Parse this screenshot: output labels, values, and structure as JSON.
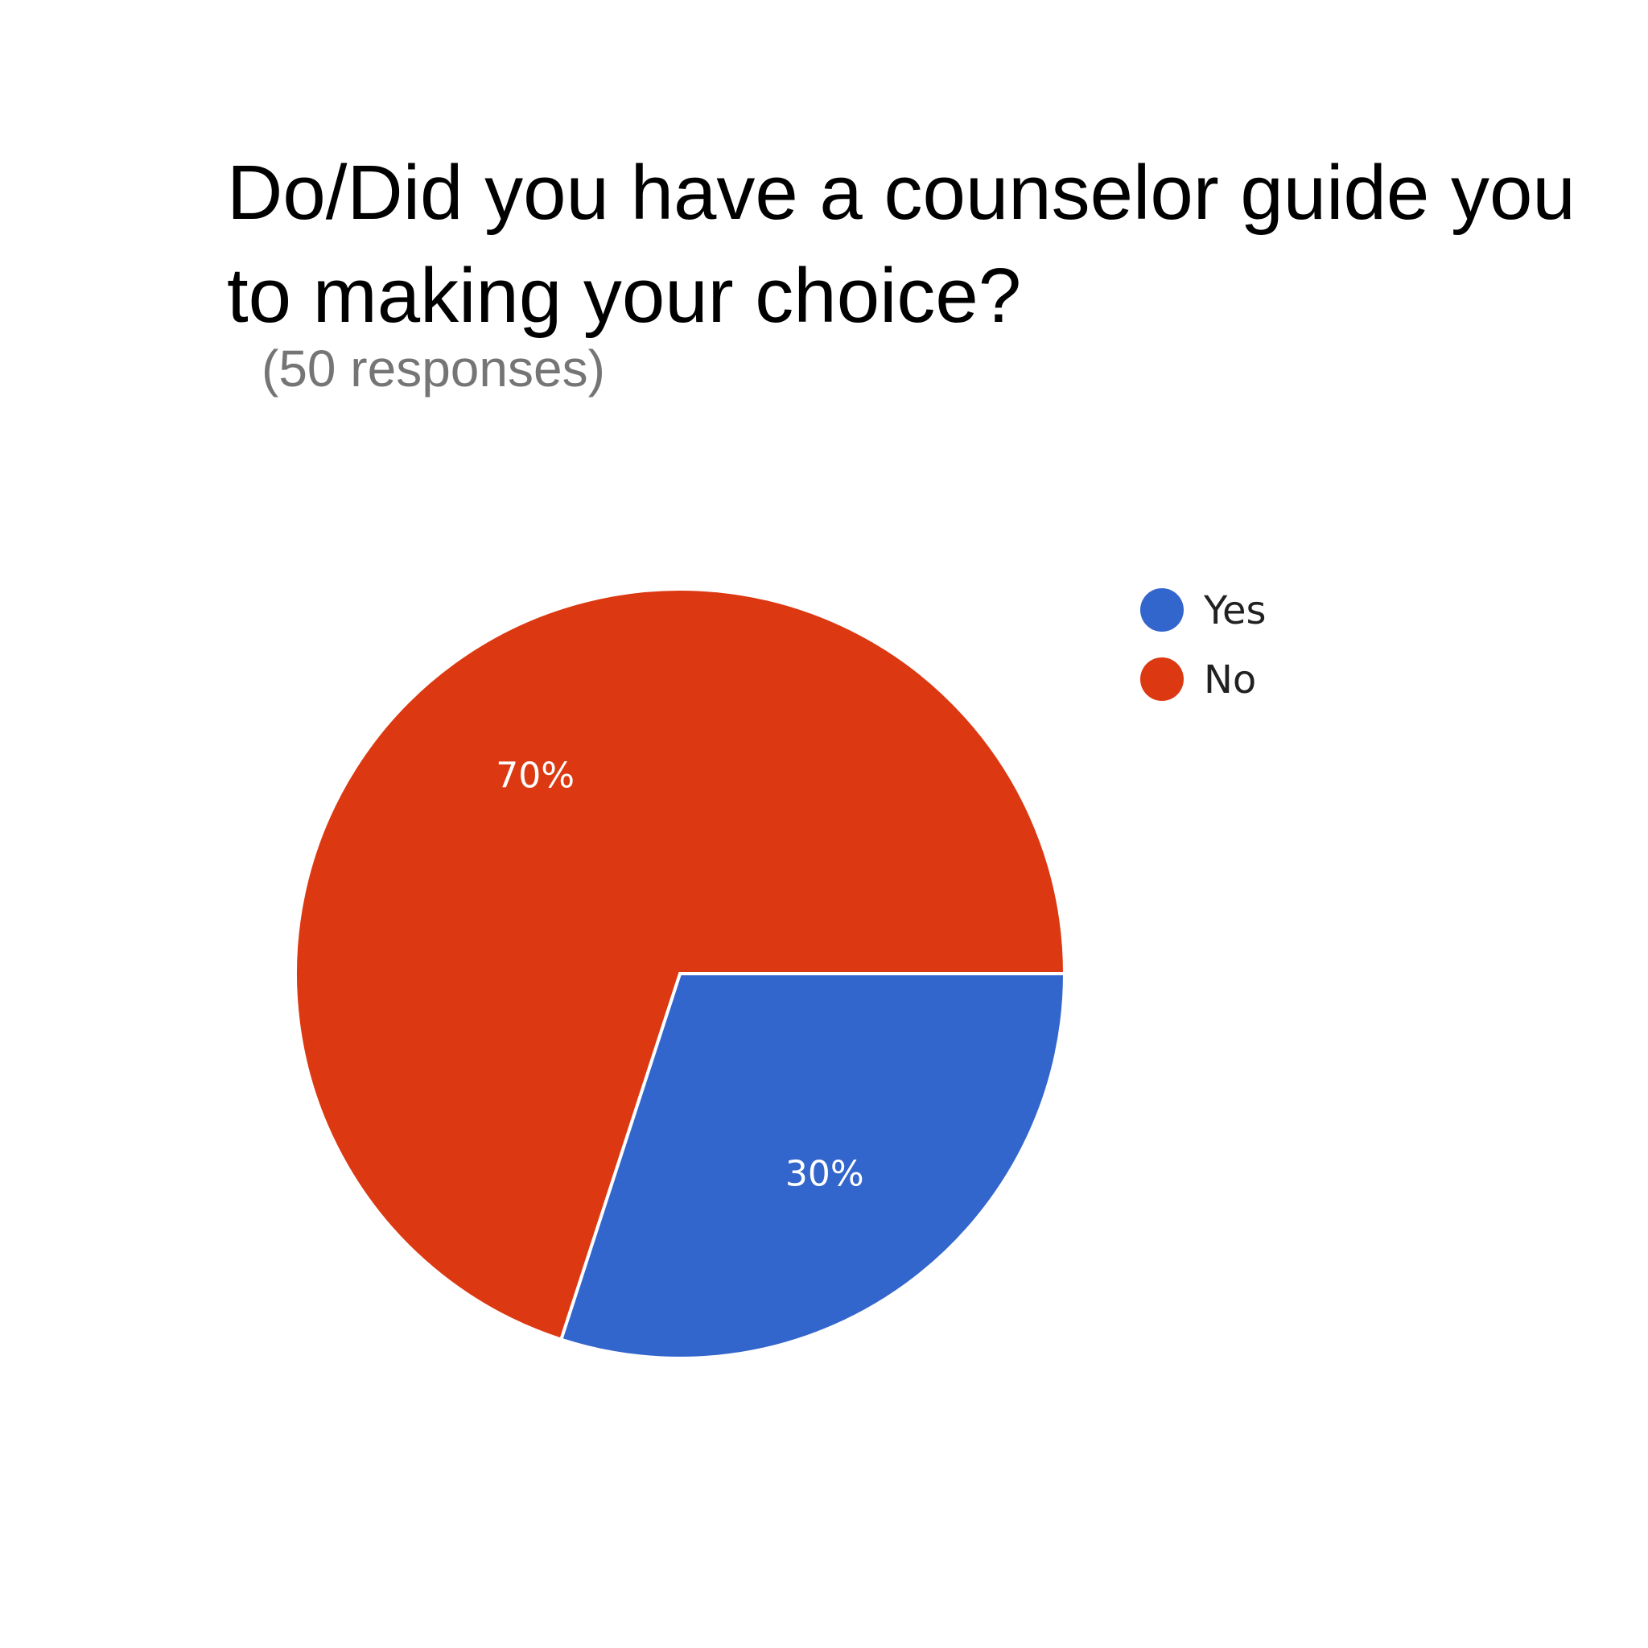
{
  "chart_data": {
    "type": "pie",
    "title": "Do/Did you have a counselor guide you to making your choice?",
    "subtitle": "(50 responses)",
    "categories": [
      "Yes",
      "No"
    ],
    "values": [
      30,
      70
    ],
    "labels": [
      "30%",
      "70%"
    ],
    "colors": [
      "#3366cc",
      "#dc3912"
    ],
    "legend_position": "right"
  }
}
